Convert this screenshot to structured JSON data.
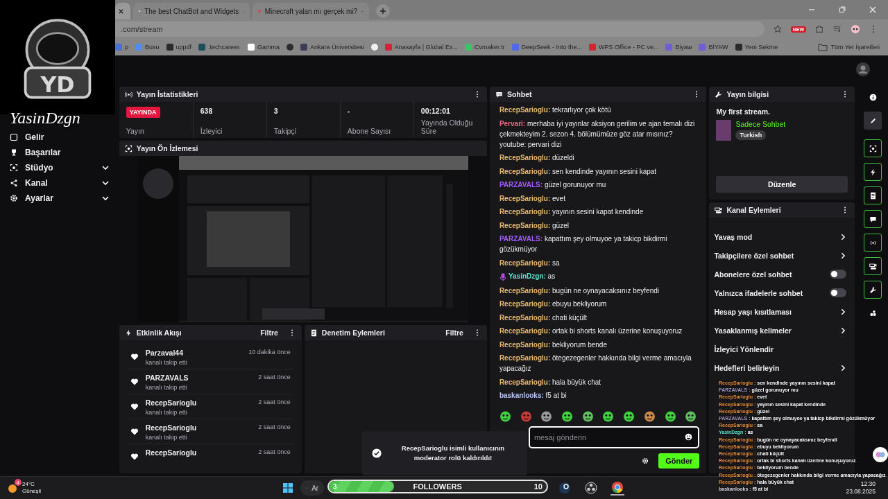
{
  "browser": {
    "tabs": [
      {
        "selected": true
      },
      {
        "title": "The best ChatBot and Widgets",
        "selected": false
      },
      {
        "title": "Minecraft yalan mı gerçek mi?",
        "selected": false
      }
    ],
    "url": ".com/stream",
    "new_badge": "NEW",
    "bookmarks": [
      {
        "label": "p",
        "color": "#4a6fd8"
      },
      {
        "label": "Busu",
        "color": "#4a8ff0"
      },
      {
        "label": "uppdf",
        "color": "#2a2a2a"
      },
      {
        "label": ".techcareer.",
        "color": "#1d4f5a"
      },
      {
        "label": "Gamma",
        "color": "#ffffff"
      },
      {
        "color": "#2a2a2a"
      },
      {
        "label": "Ankara Üniversitesi",
        "color": "#3a3f55"
      },
      {
        "color": "#f0f0f0"
      },
      {
        "label": "Anasayfa | Global Ex...",
        "color": "#d6213c"
      },
      {
        "label": "Cvmaker.tr",
        "color": "#39c46a"
      },
      {
        "label": "DeepSeek - Into the...",
        "color": "#4f6bed"
      },
      {
        "label": "WPS Office - PC ve...",
        "color": "#d9232e"
      },
      {
        "label": "Biyaw",
        "color": "#6d5fd6"
      },
      {
        "label": "BİYAW",
        "color": "#6d5fd6"
      },
      {
        "label": "Yeni Sekme",
        "color": "#2a2a2a"
      }
    ],
    "all_bookmarks": "Tüm Yer İşaretleri"
  },
  "logo": {
    "text": "YD",
    "overlay_name": "YasinDzgn"
  },
  "sidebar": {
    "items": [
      {
        "label": "Gelir",
        "expandable": false
      },
      {
        "label": "Başarılar",
        "expandable": false
      },
      {
        "label": "Stüdyo",
        "expandable": true
      },
      {
        "label": "Kanal",
        "expandable": true
      },
      {
        "label": "Ayarlar",
        "expandable": true
      }
    ]
  },
  "stats": {
    "title": "Yayın İstatistikleri",
    "cells": [
      {
        "kind": "badge",
        "value": "YAYINDA",
        "label": "Yayın"
      },
      {
        "kind": "number",
        "value": "638",
        "label": "İzleyici"
      },
      {
        "kind": "number",
        "value": "3",
        "label": "Takipçi"
      },
      {
        "kind": "number",
        "value": "-",
        "label": "Abone Sayısı"
      },
      {
        "kind": "number",
        "value": "00:12:01",
        "label": "Yayında Olduğu Süre"
      }
    ]
  },
  "preview": {
    "title": "Yayın Ön İzlemesi"
  },
  "activity": {
    "title": "Etkinlik Akışı",
    "filter": "Filtre",
    "items": [
      {
        "name": "Parzaval44",
        "action": "kanalı takip etti",
        "time": "10 dakika önce"
      },
      {
        "name": "PARZAVALS",
        "action": "kanalı takip etti",
        "time": "2 saat önce"
      },
      {
        "name": "RecepSarioglu",
        "action": "kanalı takip etti",
        "time": "2 saat önce"
      },
      {
        "name": "RecepSarioglu",
        "action": "kanalı takip etti",
        "time": "2 saat önce"
      },
      {
        "name": "RecepSarioglu",
        "time": "2 saat önce"
      }
    ]
  },
  "moderation": {
    "title": "Denetim Eylemleri",
    "filter": "Filtre"
  },
  "chat": {
    "title": "Sohbet",
    "messages": [
      {
        "user": "RecepSarioglu:",
        "color": "#e9b96e",
        "broadcaster": false,
        "text": "tekrarlıyor çok kötü"
      },
      {
        "user": "Pervari:",
        "color": "#ef6a86",
        "broadcaster": false,
        "text": "merhaba iyi yayınlar aksiyon gerilim ve ajan temalı dizi çekmekteyim 2. sezon 4. bölümümüze göz atar mısınız? youtube: pervari dizi"
      },
      {
        "user": "RecepSarioglu:",
        "color": "#e9b96e",
        "broadcaster": false,
        "text": "düzeldi"
      },
      {
        "user": "RecepSarioglu:",
        "color": "#e9b96e",
        "broadcaster": false,
        "text": "sen kendinde yayının sesini kapat"
      },
      {
        "user": "PARZAVALS:",
        "color": "#a25bff",
        "broadcaster": false,
        "text": "güzel gorunuyor mu"
      },
      {
        "user": "RecepSarioglu:",
        "color": "#e9b96e",
        "broadcaster": false,
        "text": "evet"
      },
      {
        "user": "RecepSarioglu:",
        "color": "#e9b96e",
        "broadcaster": false,
        "text": "yayının sesini kapat kendinde"
      },
      {
        "user": "RecepSarioglu:",
        "color": "#e9b96e",
        "broadcaster": false,
        "text": "güzel"
      },
      {
        "user": "PARZAVALS:",
        "color": "#a25bff",
        "broadcaster": false,
        "text": "kapattım şey olmuyoe ya takicp bikdirmi gözükmüyor"
      },
      {
        "user": "RecepSarioglu:",
        "color": "#e9b96e",
        "broadcaster": false,
        "text": "sa"
      },
      {
        "user": "YasinDzgn:",
        "color": "#5ee2d0",
        "broadcaster": true,
        "text": "as"
      },
      {
        "user": "RecepSarioglu:",
        "color": "#e9b96e",
        "broadcaster": false,
        "text": "bugün ne oynayacaksınız beyfendi"
      },
      {
        "user": "RecepSarioglu:",
        "color": "#e9b96e",
        "broadcaster": false,
        "text": "ebuyu bekliyorum"
      },
      {
        "user": "RecepSarioglu:",
        "color": "#e9b96e",
        "broadcaster": false,
        "text": "chati küçült"
      },
      {
        "user": "RecepSarioglu:",
        "color": "#e9b96e",
        "broadcaster": false,
        "text": "ortak bi shorts kanalı üzerine konuşuyoruz"
      },
      {
        "user": "RecepSarioglu:",
        "color": "#e9b96e",
        "broadcaster": false,
        "text": "bekliyorum bende"
      },
      {
        "user": "RecepSarioglu:",
        "color": "#e9b96e",
        "broadcaster": false,
        "text": "ötegezegenler hakkında bilgi verme amacıyla yapacağız"
      },
      {
        "user": "RecepSarioglu:",
        "color": "#e9b96e",
        "broadcaster": false,
        "text": "hala büyük chat"
      },
      {
        "user": "baskanlooks:",
        "color": "#b6c6f5",
        "broadcaster": false,
        "text": "f5 at bi"
      }
    ],
    "emotes": [
      {
        "color": "#3fd13f"
      },
      {
        "color": "#c83a3a"
      },
      {
        "color": "#9a9a9a"
      },
      {
        "color": "#3fd13f"
      },
      {
        "color": "#5fbf5f"
      },
      {
        "color": "#3fd13f"
      },
      {
        "color": "#3fd13f"
      },
      {
        "color": "#c98a4a"
      },
      {
        "color": "#3fd13f"
      },
      {
        "color": "#5fbf5f"
      }
    ],
    "placeholder": "mesaj gönderin",
    "send": "Gönder"
  },
  "stream_info": {
    "title": "Yayın bilgisi",
    "stream_title": "My first stream.",
    "category": "Sadece Sohbet",
    "tag": "Turkish",
    "edit": "Düzenle"
  },
  "channel_actions": {
    "title": "Kanal Eylemleri",
    "items": [
      {
        "kind": "link",
        "label": "Yavaş mod"
      },
      {
        "kind": "link",
        "label": "Takipçilere özel sohbet"
      },
      {
        "kind": "toggle",
        "label": "Abonelere özel sohbet",
        "on": false
      },
      {
        "kind": "toggle",
        "label": "Yalnızca ifadelerle sohbet",
        "on": false
      },
      {
        "kind": "link",
        "label": "Hesap yaşı kısıtlaması"
      },
      {
        "kind": "link",
        "label": "Yasaklanmış kelimeler"
      },
      {
        "kind": "plain",
        "label": "İzleyici Yönlendir"
      },
      {
        "kind": "link",
        "label": "Hedefleri belirleyin"
      }
    ]
  },
  "rail": [
    {
      "kind": "plain",
      "selected": false
    },
    {
      "kind": "plain",
      "selected": true
    },
    {
      "kind": "tool",
      "selected": false
    },
    {
      "kind": "tool",
      "selected": false
    },
    {
      "kind": "tool",
      "selected": false
    },
    {
      "kind": "tool",
      "selected": false
    },
    {
      "kind": "tool",
      "selected": false
    },
    {
      "kind": "tool",
      "selected": false
    },
    {
      "kind": "tool",
      "selected": false
    },
    {
      "kind": "plain",
      "selected": false
    }
  ],
  "toast": {
    "text": "RecepSarioglu isimli kullanıcının moderator rolü kaldırıldı!"
  },
  "overlay_chat": [
    {
      "user": "RecepSarioglu :",
      "color": "#e8903c",
      "text": "sen kendinde yayının sesini kapat"
    },
    {
      "user": "PARZAVALS :",
      "color": "#a597c4",
      "text": "güzel gorunuyor mu"
    },
    {
      "user": "RecepSarioglu :",
      "color": "#e8903c",
      "text": "evet"
    },
    {
      "user": "RecepSarioglu :",
      "color": "#e8903c",
      "text": "yayının sesini kapat kendinde"
    },
    {
      "user": "RecepSarioglu :",
      "color": "#e8903c",
      "text": "güzel"
    },
    {
      "user": "PARZAVALS :",
      "color": "#a597c4",
      "text": "kapattım şey olmuyoe ya takicp bikdirmi gözükmüyor"
    },
    {
      "user": "RecepSarioglu :",
      "color": "#e8903c",
      "text": "sa"
    },
    {
      "user": "YasinDzgn :",
      "color": "#5ee2d0",
      "text": "as"
    },
    {
      "user": "RecepSarioglu :",
      "color": "#e8903c",
      "text": "bugün ne oynayacaksınız beyfendi"
    },
    {
      "user": "RecepSarioglu :",
      "color": "#e8903c",
      "text": "ebuyu bekliyorum"
    },
    {
      "user": "RecepSarioglu :",
      "color": "#e8903c",
      "text": "chati küçült"
    },
    {
      "user": "RecepSarioglu :",
      "color": "#e8903c",
      "text": "ortak bi shorts kanalı üzerine konuşuyoruz"
    },
    {
      "user": "RecepSarioglu :",
      "color": "#e8903c",
      "text": "bekliyorum bende"
    },
    {
      "user": "RecepSarioglu :",
      "color": "#e8903c",
      "text": "ötegezegenler hakkında bilgi verme amacıyla yapacağız"
    },
    {
      "user": "RecepSarioglu :",
      "color": "#e8903c",
      "text": "hala büyük chat"
    },
    {
      "user": "baskanlooks :",
      "color": "#d8d8e8",
      "text": "f5 at bi"
    }
  ],
  "taskbar": {
    "weather_badge": "4",
    "temperature": "24°C",
    "weather": "Güneşli",
    "search": "Ar",
    "followers": {
      "current": "3",
      "label": "FOLLOWERS",
      "goal": "10",
      "level": 0.3
    },
    "time": "12:30",
    "date": "23.08.2025"
  }
}
